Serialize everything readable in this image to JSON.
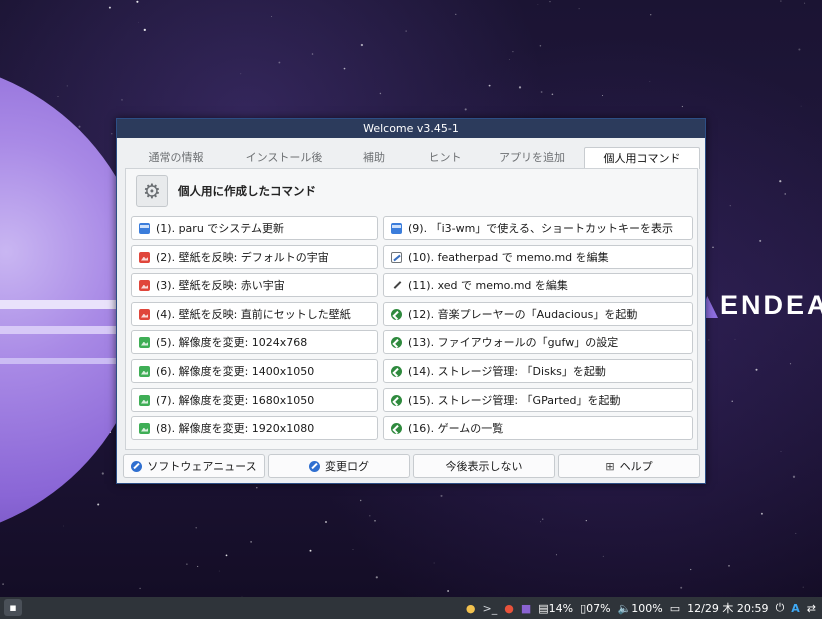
{
  "desktop": {
    "brand_text": "ENDEAVOU"
  },
  "window": {
    "title": "Welcome v3.45-1",
    "tabs": [
      {
        "label": "通常の情報"
      },
      {
        "label": "インストール後"
      },
      {
        "label": "補助"
      },
      {
        "label": "ヒント"
      },
      {
        "label": "アプリを追加"
      },
      {
        "label": "個人用コマンド"
      }
    ],
    "active_tab": "個人用コマンド",
    "panel_title": "個人用に作成したコマンド",
    "left_commands": [
      {
        "label": "(1). paru でシステム更新",
        "icon": "terminal-update-icon"
      },
      {
        "label": "(2). 壁紙を反映: デフォルトの宇宙",
        "icon": "wallpaper-icon"
      },
      {
        "label": "(3). 壁紙を反映: 赤い宇宙",
        "icon": "wallpaper-icon"
      },
      {
        "label": "(4). 壁紙を反映: 直前にセットした壁紙",
        "icon": "wallpaper-icon"
      },
      {
        "label": "(5). 解像度を変更: 1024x768",
        "icon": "display-icon"
      },
      {
        "label": "(6). 解像度を変更: 1400x1050",
        "icon": "display-icon"
      },
      {
        "label": "(7). 解像度を変更: 1680x1050",
        "icon": "display-icon"
      },
      {
        "label": "(8). 解像度を変更: 1920x1080",
        "icon": "display-icon"
      }
    ],
    "right_commands": [
      {
        "label": "(9). 「i3-wm」で使える、ショートカットキーを表示",
        "icon": "keyboard-icon"
      },
      {
        "label": "(10). featherpad で memo.md を編集",
        "icon": "featherpad-icon"
      },
      {
        "label": "(11). xed で memo.md を編集",
        "icon": "pen-icon"
      },
      {
        "label": "(12). 音楽プレーヤーの「Audacious」を起動",
        "icon": "launch-icon"
      },
      {
        "label": "(13). ファイアウォールの「gufw」の設定",
        "icon": "launch-icon"
      },
      {
        "label": "(14). ストレージ管理: 「Disks」を起動",
        "icon": "launch-icon"
      },
      {
        "label": "(15). ストレージ管理: 「GParted」を起動",
        "icon": "launch-icon"
      },
      {
        "label": "(16). ゲームの一覧",
        "icon": "launch-icon"
      }
    ],
    "buttons": {
      "news": "ソフトウェアニュース",
      "changelog": "変更ログ",
      "dont_show": "今後表示しない",
      "help": "ヘルプ"
    }
  },
  "taskbar": {
    "battery1": "14%",
    "battery2": "07%",
    "volume": "100%",
    "datetime": "12/29 木 20:59",
    "keyboard_layout": "A"
  }
}
